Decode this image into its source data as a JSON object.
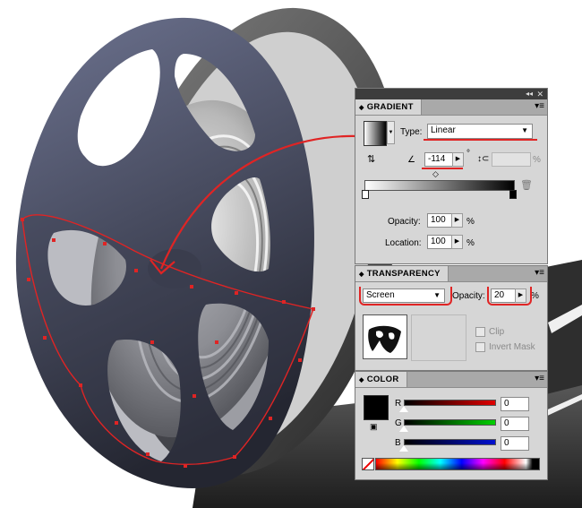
{
  "gradient_panel": {
    "title": "GRADIENT",
    "type_label": "Type:",
    "type_value": "Linear",
    "angle_value": "-114",
    "angle_unit": "°",
    "aspect_value": "",
    "aspect_unit": "%",
    "opacity_label": "Opacity:",
    "opacity_value": "100",
    "opacity_unit": "%",
    "location_label": "Location:",
    "location_value": "100",
    "location_unit": "%"
  },
  "transparency_panel": {
    "title": "TRANSPARENCY",
    "blend_mode": "Screen",
    "opacity_label": "Opacity:",
    "opacity_value": "20",
    "opacity_unit": "%",
    "clip_label": "Clip",
    "invert_mask_label": "Invert Mask"
  },
  "color_panel": {
    "title": "COLOR",
    "r_label": "R",
    "r_value": "0",
    "g_label": "G",
    "g_value": "0",
    "b_label": "B",
    "b_value": "0"
  },
  "icons": [
    "collapse-icon",
    "close-icon",
    "panel-menu-icon",
    "dropdown-arrow-icon",
    "stepper-arrow-icon",
    "trash-icon",
    "aspect-ratio-icon",
    "swap-icon",
    "fill-swatch-icon",
    "none-swatch-icon"
  ],
  "colors": {
    "annotation_red": "#e02424",
    "reel_dark": "#2f3240",
    "reel_light": "#676d8a",
    "panel_bg": "#d6d6d6"
  }
}
